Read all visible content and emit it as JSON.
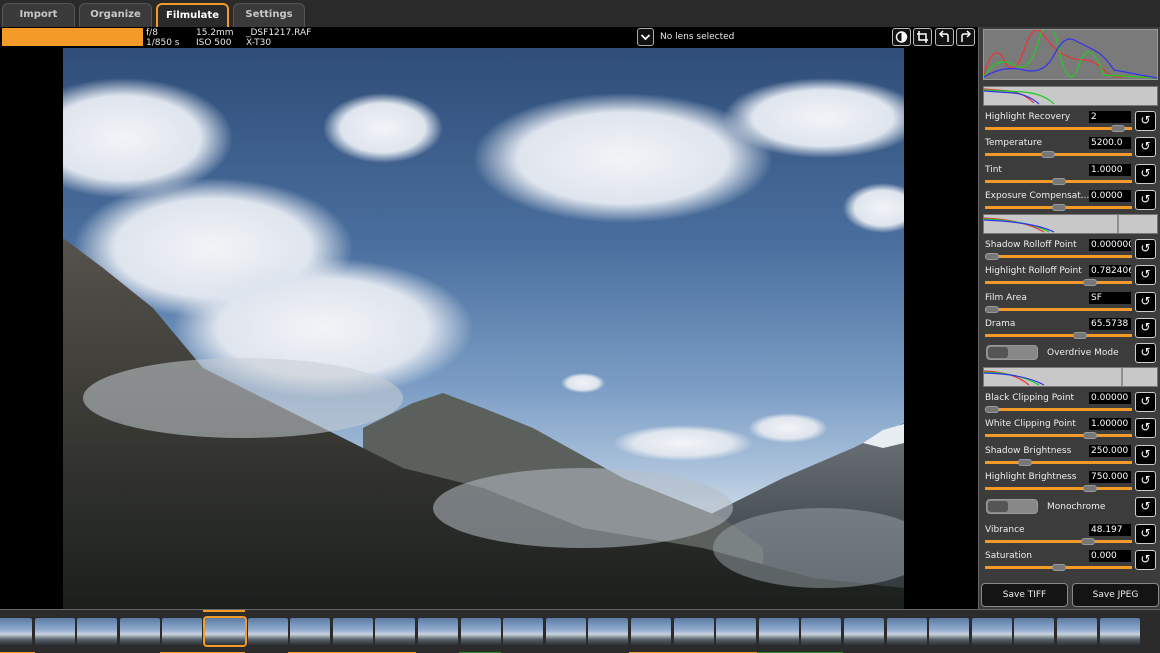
{
  "tabs": [
    {
      "label": "Import",
      "active": false
    },
    {
      "label": "Organize",
      "active": false
    },
    {
      "label": "Filmulate",
      "active": true
    },
    {
      "label": "Settings",
      "active": false
    }
  ],
  "info": {
    "aperture": "f/8",
    "shutter": "1/850 s",
    "focal_length": "15.2mm",
    "iso": "ISO 500",
    "filename": "_DSF1217.RAF",
    "camera": "X-T30",
    "lens": "No lens selected",
    "progress_percent": 100
  },
  "controls_group1": [
    {
      "label": "Highlight Recovery",
      "value": "2",
      "slider": 0.95
    },
    {
      "label": "Temperature",
      "value": "5200.0",
      "slider": 0.42
    },
    {
      "label": "Tint",
      "value": "1.0000",
      "slider": 0.5
    },
    {
      "label": "Exposure Compensat...",
      "value": "0.0000",
      "slider": 0.5
    }
  ],
  "controls_group2": [
    {
      "label": "Shadow Rolloff Point",
      "value": "0.000000",
      "slider": 0.0
    },
    {
      "label": "Highlight Rolloff Point",
      "value": "0.782406",
      "slider": 0.74
    },
    {
      "label": "Film Area",
      "value": "SF",
      "slider": 0.0
    },
    {
      "label": "Drama",
      "value": "65.5738",
      "slider": 0.66
    }
  ],
  "overdrive": {
    "label": "Overdrive Mode",
    "on": false
  },
  "controls_group3": [
    {
      "label": "Black Clipping Point",
      "value": "0.00000",
      "slider": 0.0
    },
    {
      "label": "White Clipping Point",
      "value": "1.00000",
      "slider": 0.74
    },
    {
      "label": "Shadow Brightness",
      "value": "250.000",
      "slider": 0.25
    },
    {
      "label": "Highlight Brightness",
      "value": "750.000",
      "slider": 0.74
    }
  ],
  "monochrome": {
    "label": "Monochrome",
    "on": false
  },
  "controls_group4": [
    {
      "label": "Vibrance",
      "value": "48.197",
      "slider": 0.72
    },
    {
      "label": "Saturation",
      "value": "0.000",
      "slider": 0.5
    }
  ],
  "buttons": {
    "save_tiff": "Save TIFF",
    "save_jpeg": "Save JPEG"
  },
  "filmstrip": {
    "count": 27,
    "selected_index": 5
  },
  "colors": {
    "accent": "#f39a28",
    "panel": "#3c3c3c",
    "background": "#1e1e1e"
  }
}
